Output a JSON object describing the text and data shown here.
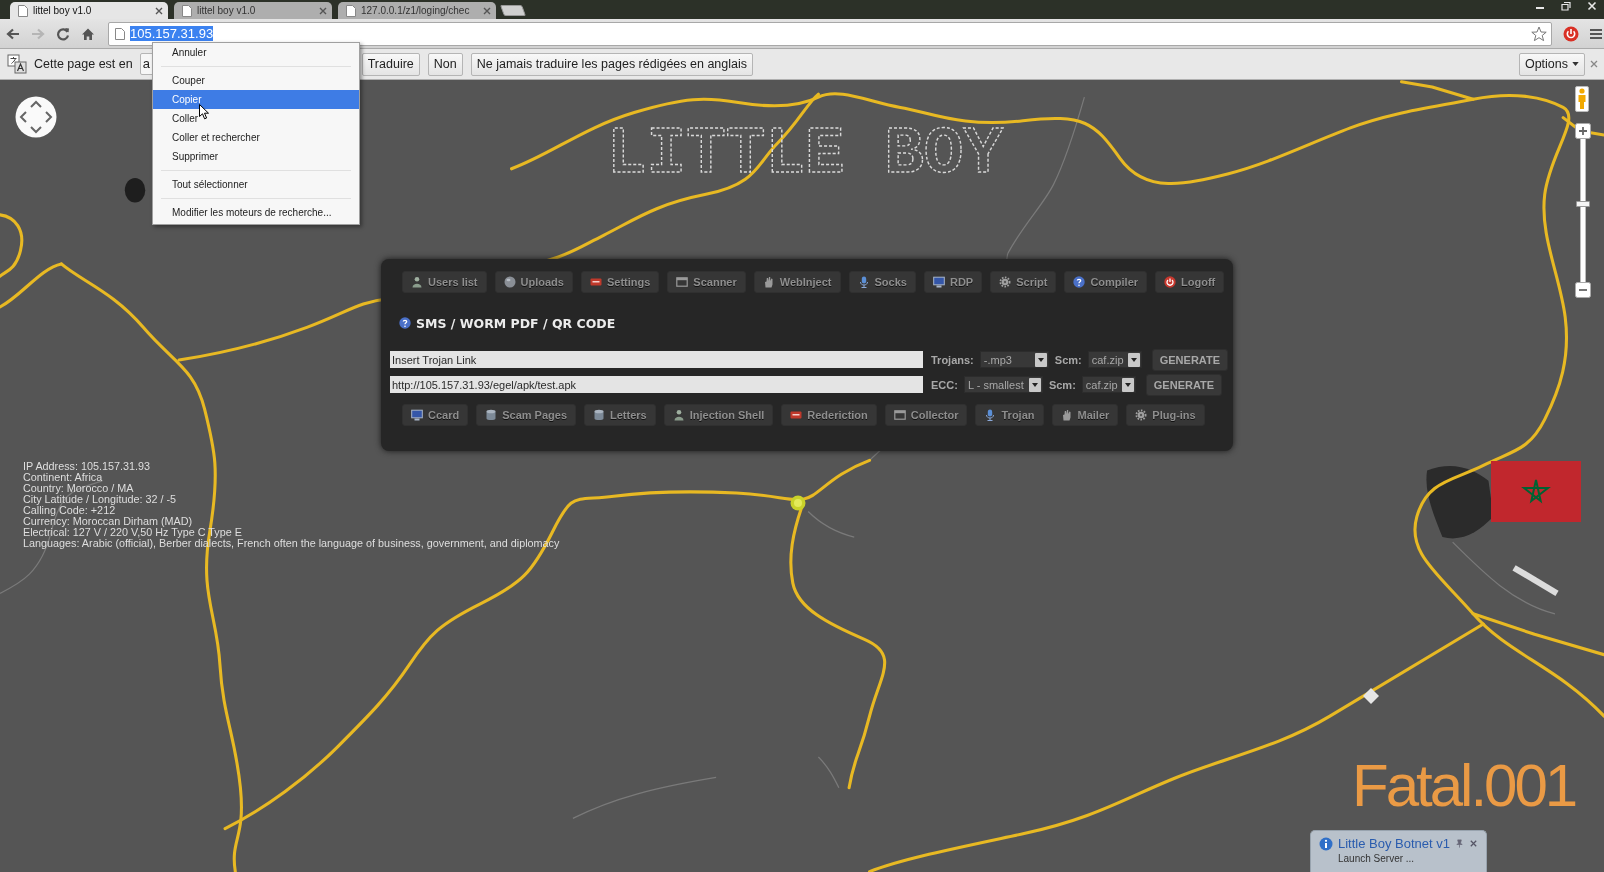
{
  "browser": {
    "tabs": [
      {
        "title": "littel boy v1.0",
        "selected": true
      },
      {
        "title": "littel boy v1.0",
        "selected": false
      },
      {
        "title": "127.0.0.1/z1/loging/chec",
        "selected": false
      }
    ],
    "nav_buttons": [
      {
        "kind": "back",
        "disabled": false
      },
      {
        "kind": "forward",
        "disabled": true
      },
      {
        "kind": "reload",
        "disabled": false
      },
      {
        "kind": "home",
        "disabled": false
      }
    ],
    "address_bar": {
      "selected_text": "105.157.31.93"
    }
  },
  "translate_bar": {
    "message": "Cette page est en",
    "language": "a",
    "buttons": [
      "Traduire",
      "Non",
      "Ne jamais traduire les pages rédigées en anglais"
    ],
    "options": "Options"
  },
  "context_menu": {
    "sections": [
      {
        "items": [
          {
            "label": "Annuler",
            "selected": false
          }
        ]
      },
      {
        "items": [
          {
            "label": "Couper",
            "selected": false
          },
          {
            "label": "Copier",
            "selected": true
          },
          {
            "label": "Coller",
            "selected": false
          },
          {
            "label": "Coller et rechercher",
            "selected": false
          },
          {
            "label": "Supprimer",
            "selected": false
          }
        ]
      },
      {
        "items": [
          {
            "label": "Tout sélectionner",
            "selected": false
          }
        ]
      },
      {
        "items": [
          {
            "label": "Modifier les moteurs de recherche...",
            "selected": false
          }
        ]
      }
    ]
  },
  "map": {
    "logo": "LITTLE BOY",
    "info_lines": [
      "IP Address: 105.157.31.93",
      "Continent: Africa",
      "Country: Morocco / MA",
      "City Latitude / Longitude: 32 / -5",
      "Calling Code: +212",
      "Currency: Moroccan Dirham (MAD)",
      "Electrical: 127 V / 220 V,50 Hz Type C Type E",
      "Languages: Arabic (official), Berber dialects, French often the language of business, government, and diplomacy"
    ],
    "signature": "Fatal.001",
    "zoom": {
      "level": 0.55
    }
  },
  "panel": {
    "top_nav": [
      "Users list",
      "Uploads",
      "Settings",
      "Scanner",
      "WebInject",
      "Socks",
      "RDP",
      "Script",
      "Compiler",
      "Logoff"
    ],
    "title": "SMS / WORM PDF / QR CODE",
    "rows": [
      {
        "link": "Insert Trojan Link",
        "options": [
          {
            "label": "Trojans:",
            "value": "-.mp3"
          },
          {
            "label": "Scm:",
            "value": "caf.zip"
          }
        ],
        "button": "GENERATE"
      },
      {
        "link": "http://105.157.31.93/egel/apk/test.apk",
        "options": [
          {
            "label": "ECC:",
            "value": "L - smallest"
          },
          {
            "label": "Scm:",
            "value": "caf.zip"
          }
        ],
        "button": "GENERATE"
      }
    ],
    "bottom_nav": [
      "Ccard",
      "Scam Pages",
      "Letters",
      "Injection Shell",
      "Rederiction",
      "Collector",
      "Trojan",
      "Mailer",
      "Plug-ins"
    ]
  },
  "notification": {
    "title": "Little Boy Botnet v1",
    "message": "Launch Server ..."
  }
}
